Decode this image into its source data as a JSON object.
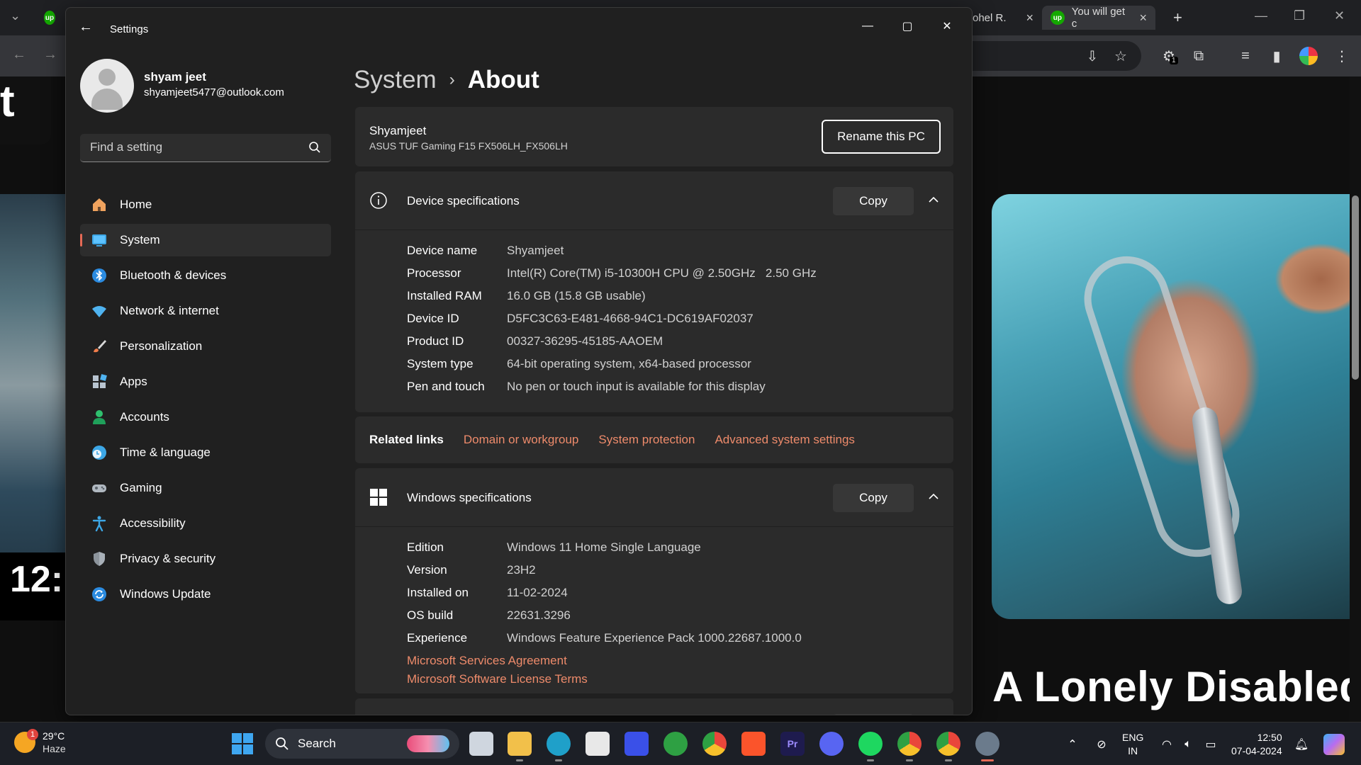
{
  "browser": {
    "tabs": [
      {
        "title": "ohel R."
      },
      {
        "title": "You will get c"
      }
    ],
    "extension_badge": "1",
    "page_text_fragment": "t",
    "clock_fragment": "12:",
    "video_title": "A Lonely Disabled M"
  },
  "window": {
    "title": "Settings",
    "minimize": "—",
    "maximize": "▢",
    "close": "✕"
  },
  "profile": {
    "name": "shyam jeet",
    "email": "shyamjeet5477@outlook.com"
  },
  "search": {
    "placeholder": "Find a setting"
  },
  "nav": [
    {
      "label": "Home",
      "icon": "home-icon"
    },
    {
      "label": "System",
      "icon": "system-icon",
      "selected": true
    },
    {
      "label": "Bluetooth & devices",
      "icon": "bluetooth-icon"
    },
    {
      "label": "Network & internet",
      "icon": "wifi-icon"
    },
    {
      "label": "Personalization",
      "icon": "brush-icon"
    },
    {
      "label": "Apps",
      "icon": "apps-icon"
    },
    {
      "label": "Accounts",
      "icon": "accounts-icon"
    },
    {
      "label": "Time & language",
      "icon": "time-language-icon"
    },
    {
      "label": "Gaming",
      "icon": "gaming-icon"
    },
    {
      "label": "Accessibility",
      "icon": "accessibility-icon"
    },
    {
      "label": "Privacy & security",
      "icon": "shield-icon"
    },
    {
      "label": "Windows Update",
      "icon": "update-icon"
    }
  ],
  "breadcrumb": {
    "parent": "System",
    "separator": "›",
    "current": "About"
  },
  "pc": {
    "name": "Shyamjeet",
    "model": "ASUS TUF Gaming F15 FX506LH_FX506LH",
    "rename_label": "Rename this PC"
  },
  "device_specs": {
    "title": "Device specifications",
    "copy_label": "Copy",
    "rows": [
      {
        "key": "Device name",
        "value": "Shyamjeet"
      },
      {
        "key": "Processor",
        "value": "Intel(R) Core(TM) i5-10300H CPU @ 2.50GHz   2.50 GHz"
      },
      {
        "key": "Installed RAM",
        "value": "16.0 GB (15.8 GB usable)"
      },
      {
        "key": "Device ID",
        "value": "D5FC3C63-E481-4668-94C1-DC619AF02037"
      },
      {
        "key": "Product ID",
        "value": "00327-36295-45185-AAOEM"
      },
      {
        "key": "System type",
        "value": "64-bit operating system, x64-based processor"
      },
      {
        "key": "Pen and touch",
        "value": "No pen or touch input is available for this display"
      }
    ]
  },
  "related_links": {
    "label": "Related links",
    "links": [
      "Domain or workgroup",
      "System protection",
      "Advanced system settings"
    ]
  },
  "windows_specs": {
    "title": "Windows specifications",
    "copy_label": "Copy",
    "rows": [
      {
        "key": "Edition",
        "value": "Windows 11 Home Single Language"
      },
      {
        "key": "Version",
        "value": "23H2"
      },
      {
        "key": "Installed on",
        "value": "11-02-2024"
      },
      {
        "key": "OS build",
        "value": "22631.3296"
      },
      {
        "key": "Experience",
        "value": "Windows Feature Experience Pack 1000.22687.1000.0"
      }
    ],
    "links": [
      "Microsoft Services Agreement",
      "Microsoft Software License Terms"
    ]
  },
  "taskbar": {
    "weather": {
      "temp": "29°C",
      "condition": "Haze",
      "badge": "1"
    },
    "search_label": "Search",
    "apps": [
      {
        "name": "task-view",
        "color": "#cfd6df"
      },
      {
        "name": "file-explorer",
        "color": "#f2c04a"
      },
      {
        "name": "edge",
        "color": "#1fa0c9"
      },
      {
        "name": "microsoft-store",
        "color": "#e8e8e8"
      },
      {
        "name": "app-blue",
        "color": "#3a50e8"
      },
      {
        "name": "xbox",
        "color": "#2ea043"
      },
      {
        "name": "chrome-1",
        "color": "#e9463b"
      },
      {
        "name": "brave",
        "color": "#fb542b"
      },
      {
        "name": "premiere-pro",
        "color": "#1e1b4e",
        "text": "Pr"
      },
      {
        "name": "discord",
        "color": "#5865f2"
      },
      {
        "name": "spotify",
        "color": "#1ed760"
      },
      {
        "name": "chrome-2",
        "color": "#e9463b"
      },
      {
        "name": "chrome-3",
        "color": "#e9463b"
      },
      {
        "name": "settings",
        "color": "#6b7b8c"
      }
    ],
    "language": {
      "line1": "ENG",
      "line2": "IN"
    },
    "time": "12:50",
    "date": "07-04-2024"
  }
}
